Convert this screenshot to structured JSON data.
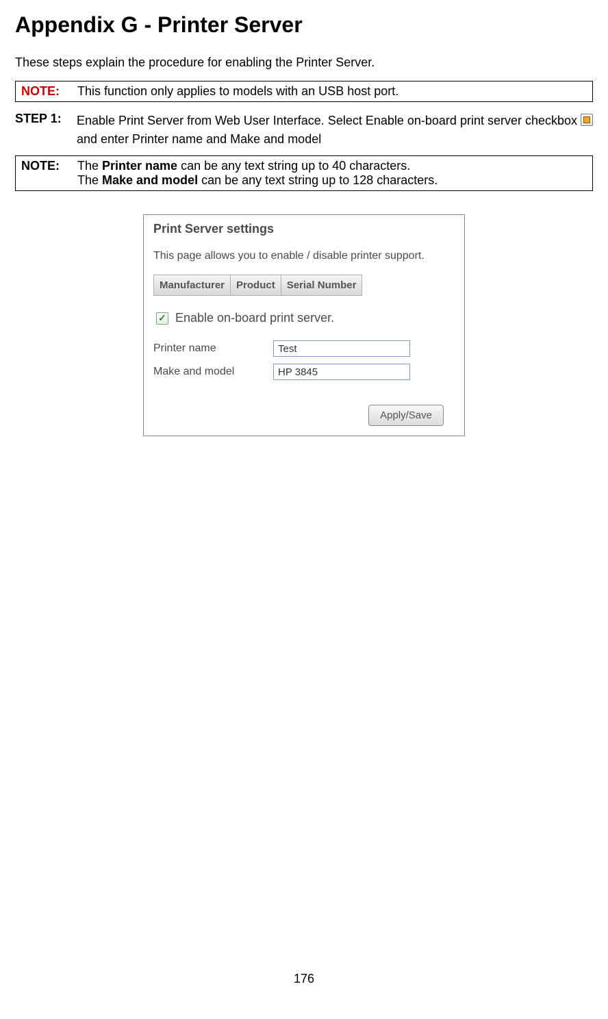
{
  "heading": "Appendix G - Printer Server",
  "intro": "These steps explain the procedure for enabling the Printer Server.",
  "note1": {
    "label": "NOTE:",
    "text": "This function only applies to models with an USB host port."
  },
  "step1": {
    "label": "STEP 1:",
    "text_a": "Enable Print Server from Web User Interface. Select Enable on-board print server checkbox ",
    "text_b": " and enter Printer name and Make and model"
  },
  "note2": {
    "label": "NOTE",
    "colon": ":",
    "line1_a": "The ",
    "line1_bold": "Printer name",
    "line1_b": " can be any text string up to 40 characters.",
    "line2_a": "The ",
    "line2_bold": "Make and model",
    "line2_b": " can be any text string up to 128 characters."
  },
  "panel": {
    "title": "Print Server settings",
    "desc": "This page allows you to enable / disable printer support.",
    "tabs": [
      "Manufacturer",
      "Product",
      "Serial Number"
    ],
    "checkbox_label": "Enable on-board print server.",
    "fields": {
      "printer_name_label": "Printer name",
      "printer_name_value": "Test",
      "make_model_label": "Make and model",
      "make_model_value": "HP 3845"
    },
    "apply_button": "Apply/Save"
  },
  "page_number": "176"
}
